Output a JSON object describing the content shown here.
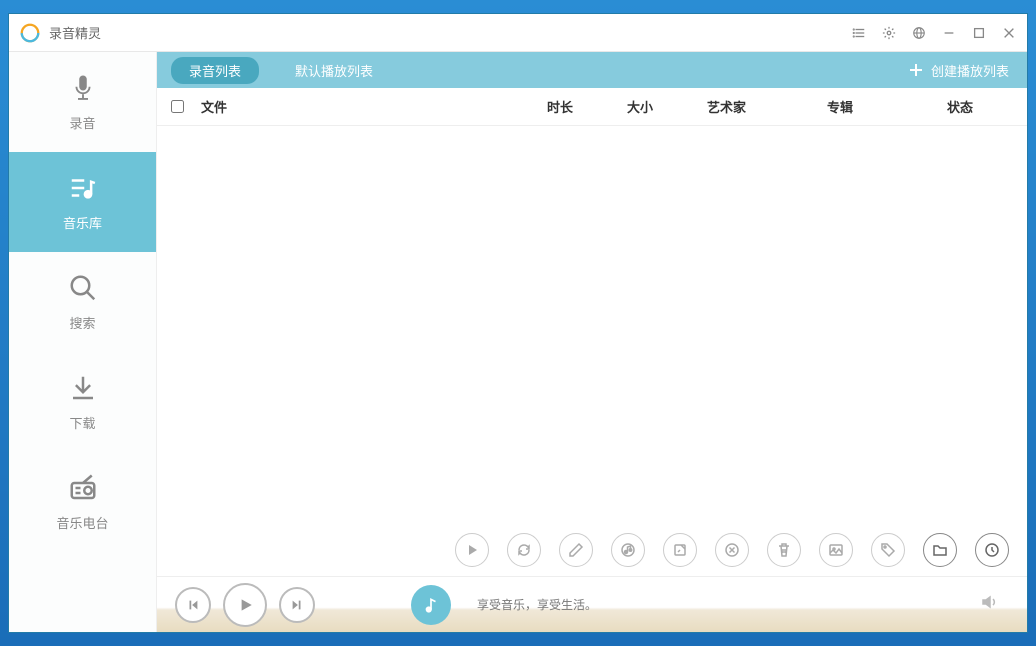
{
  "app": {
    "title": "录音精灵"
  },
  "sidebar": {
    "items": [
      {
        "label": "录音"
      },
      {
        "label": "音乐库"
      },
      {
        "label": "搜索"
      },
      {
        "label": "下载"
      },
      {
        "label": "音乐电台"
      }
    ]
  },
  "tabs": {
    "recording_list": "录音列表",
    "default_playlist": "默认播放列表",
    "create_playlist": "创建播放列表"
  },
  "columns": {
    "file": "文件",
    "duration": "时长",
    "size": "大小",
    "artist": "艺术家",
    "album": "专辑",
    "status": "状态"
  },
  "player": {
    "tagline": "享受音乐，享受生活。"
  }
}
